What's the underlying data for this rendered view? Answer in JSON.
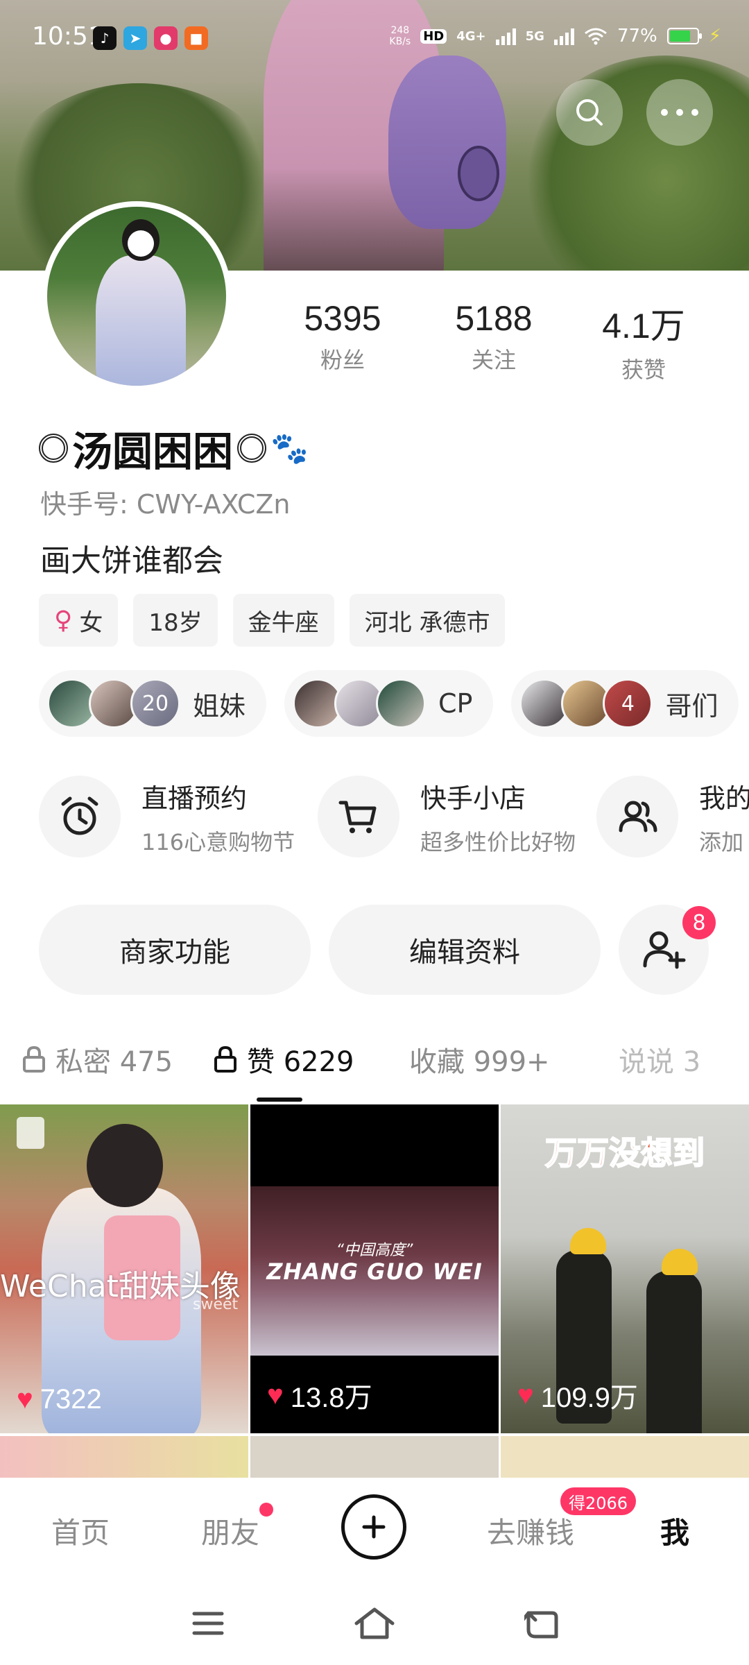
{
  "status_bar": {
    "time": "10:51",
    "net_speed_value": "248",
    "net_speed_unit": "KB/s",
    "hd": "HD",
    "net1": "4G+",
    "net2": "5G",
    "battery": "77%",
    "battery_color": "#35d34a"
  },
  "profile": {
    "stats": [
      {
        "num": "5395",
        "label": "粉丝"
      },
      {
        "num": "5188",
        "label": "关注"
      },
      {
        "num": "4.1万",
        "label": "获赞"
      }
    ],
    "nickname": "汤圆困困",
    "ks_id": "快手号: CWY-AXCZn",
    "bio": "画大饼谁都会",
    "tags": {
      "gender": "女",
      "age": "18岁",
      "zodiac": "金牛座",
      "location": "河北 承德市"
    },
    "groups": [
      {
        "count": "20",
        "name": "姐妹"
      },
      {
        "count": "",
        "name": "CP"
      },
      {
        "count": "4",
        "name": "哥们"
      }
    ]
  },
  "features": [
    {
      "title": "直播预约",
      "subtitle": "116心意购物节",
      "icon": "alarm-clock-icon"
    },
    {
      "title": "快手小店",
      "subtitle": "超多性价比好物",
      "icon": "shopping-cart-icon"
    },
    {
      "title": "我的",
      "subtitle": "添加",
      "icon": "people-icon"
    }
  ],
  "actions": {
    "merchant": "商家功能",
    "edit_profile": "编辑资料",
    "friend_badge": "8"
  },
  "tabs": {
    "private": "私密 475",
    "liked": "赞 6229",
    "collection": "收藏 999+",
    "shuoshuo": "说说 3"
  },
  "grid": [
    {
      "likes": "7322",
      "overlay": "WeChat甜妹头像",
      "sub": "sweet"
    },
    {
      "likes": "13.8万",
      "small": "“中国高度”",
      "big": "ZHANG GUO WEI"
    },
    {
      "likes": "109.9万",
      "title": "万万没想到"
    }
  ],
  "bottom_nav": {
    "home": "首页",
    "friends": "朋友",
    "earn": "去赚钱",
    "earn_badge": "得2066",
    "me": "我"
  },
  "colors": {
    "accent": "#fe3666",
    "heart": "#fe2c55",
    "muted": "#8c8c8c"
  }
}
